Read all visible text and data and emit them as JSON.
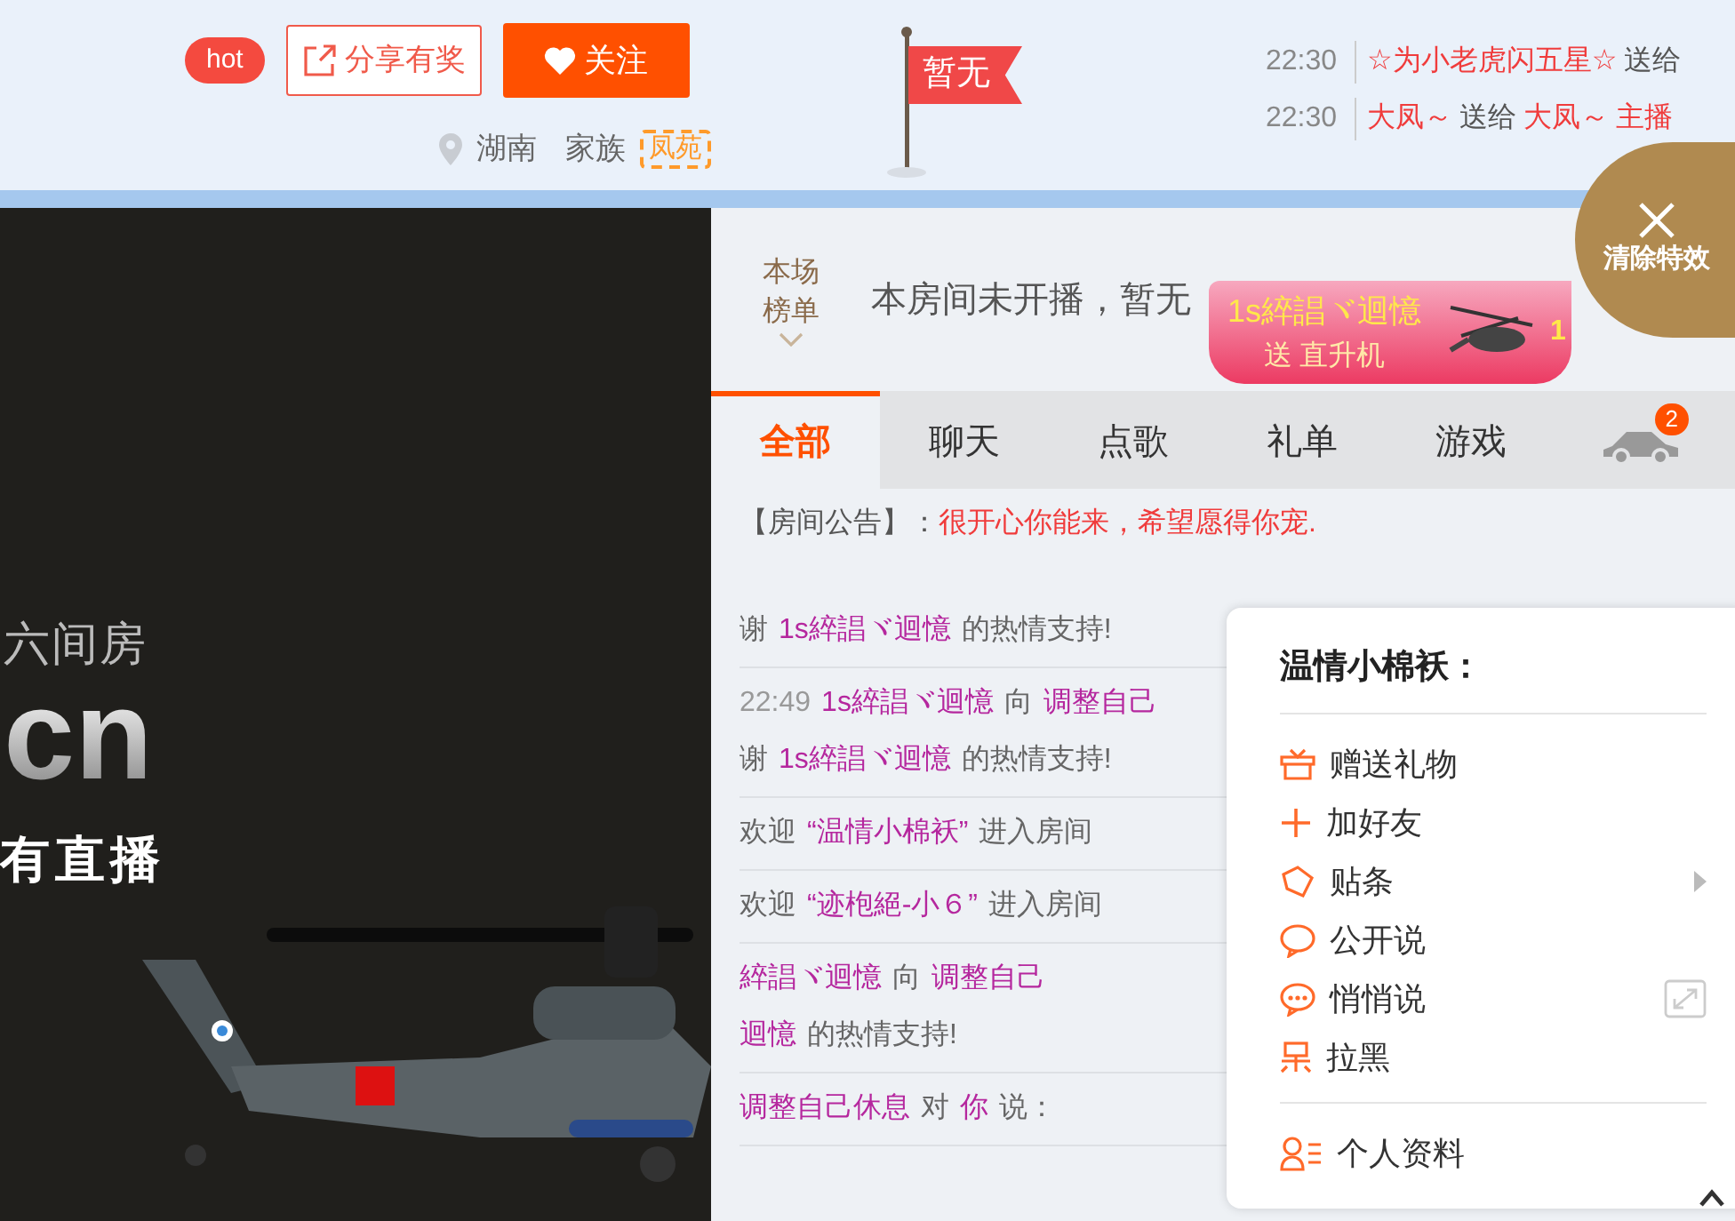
{
  "header": {
    "hot_badge": "hot",
    "share_button": "分享有奖",
    "follow_button": "关注",
    "location": "湖南",
    "family_label": "家族",
    "family_badge": "凤苑",
    "flag": "暂无"
  },
  "gift_feed": [
    {
      "time": "22:30",
      "parts": [
        {
          "text": "☆为小老虎闪五星☆",
          "kind": "name"
        },
        {
          "text": "送给",
          "kind": "plain"
        }
      ]
    },
    {
      "time": "22:30",
      "parts": [
        {
          "text": "大凤～",
          "kind": "name"
        },
        {
          "text": "送给",
          "kind": "plain"
        },
        {
          "text": "大凤～",
          "kind": "name"
        },
        {
          "text": "主播",
          "kind": "name"
        }
      ]
    }
  ],
  "player": {
    "logo_top": "六间房",
    "logo_main": "cn",
    "caption": "有直播"
  },
  "ranking": {
    "label_line1": "本场",
    "label_line2": "榜单",
    "notice": "本房间未开播，暂无"
  },
  "gift_banner": {
    "sender": "1s綷誯ヾ迴憶",
    "action": "送 直升机",
    "count": "1"
  },
  "clear_effects": {
    "label": "清除特效"
  },
  "tabs": [
    {
      "kind": "text",
      "label": "全部",
      "selected": true
    },
    {
      "kind": "text",
      "label": "聊天",
      "selected": false
    },
    {
      "kind": "text",
      "label": "点歌",
      "selected": false
    },
    {
      "kind": "text",
      "label": "礼单",
      "selected": false
    },
    {
      "kind": "text",
      "label": "游戏",
      "selected": false
    },
    {
      "kind": "car",
      "badge": "2",
      "selected": false
    }
  ],
  "announcement": {
    "label": "【房间公告】：",
    "text": "很开心你能来，希望愿得你宠."
  },
  "chat": [
    {
      "lines": [
        [
          {
            "kind": "plain",
            "text": "谢"
          },
          {
            "kind": "name",
            "text": "1s綷誯ヾ迴憶"
          },
          {
            "kind": "plain",
            "text": "的热情支持!"
          }
        ]
      ]
    },
    {
      "lines": [
        [
          {
            "kind": "time",
            "text": "22:49"
          },
          {
            "kind": "name",
            "text": "1s綷誯ヾ迴憶"
          },
          {
            "kind": "plain",
            "text": "向"
          },
          {
            "kind": "name",
            "text": "调整自己"
          }
        ],
        [
          {
            "kind": "plain",
            "text": "谢"
          },
          {
            "kind": "name",
            "text": "1s綷誯ヾ迴憶"
          },
          {
            "kind": "plain",
            "text": "的热情支持!"
          }
        ]
      ]
    },
    {
      "lines": [
        [
          {
            "kind": "plain",
            "text": "欢迎"
          },
          {
            "kind": "name",
            "text": "“温情小棉袄”"
          },
          {
            "kind": "plain",
            "text": "进入房间"
          }
        ]
      ]
    },
    {
      "lines": [
        [
          {
            "kind": "plain",
            "text": "欢迎"
          },
          {
            "kind": "name",
            "text": "“迹枹絕-小６”"
          },
          {
            "kind": "plain",
            "text": "进入房间"
          }
        ]
      ]
    },
    {
      "lines": [
        [
          {
            "kind": "name",
            "text": "綷誯ヾ迴憶"
          },
          {
            "kind": "plain",
            "text": "向"
          },
          {
            "kind": "name",
            "text": "调整自己"
          }
        ],
        [
          {
            "kind": "name",
            "text": "迴憶"
          },
          {
            "kind": "plain",
            "text": "的热情支持!"
          }
        ]
      ]
    },
    {
      "lines": [
        [
          {
            "kind": "name",
            "text": "调整自己休息"
          },
          {
            "kind": "plain",
            "text": "对"
          },
          {
            "kind": "name",
            "text": "你"
          },
          {
            "kind": "plain",
            "text": "说："
          }
        ]
      ]
    }
  ],
  "context_menu": {
    "title": "温情小棉袄：",
    "sections": [
      [
        {
          "label": "赠送礼物",
          "kind": "plain"
        },
        {
          "label": "加好友",
          "kind": "plain"
        },
        {
          "label": "贴条",
          "kind": "submenu"
        },
        {
          "label": "公开说",
          "kind": "plain"
        },
        {
          "label": "悄悄说",
          "kind": "popout"
        },
        {
          "label": "拉黑",
          "kind": "plain"
        }
      ],
      [
        {
          "label": "个人资料",
          "kind": "plain"
        }
      ]
    ]
  }
}
